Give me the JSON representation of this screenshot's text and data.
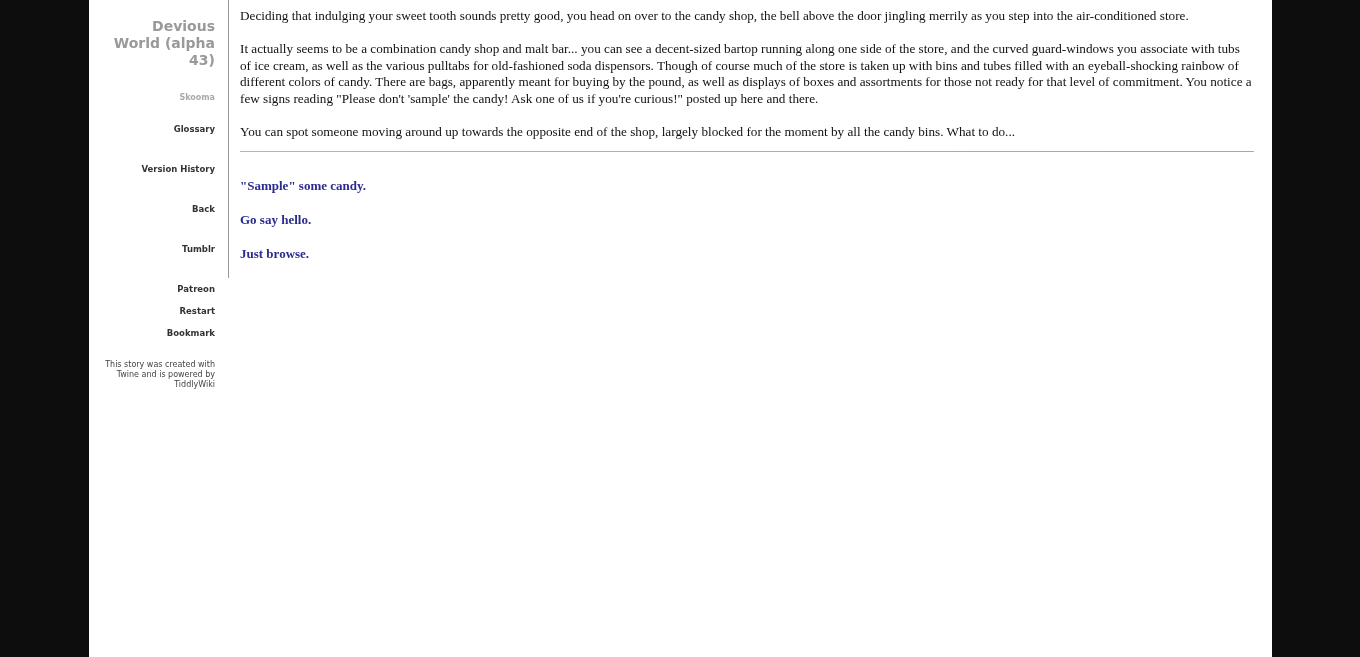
{
  "sidebar": {
    "title": "Devious World (alpha 43)",
    "subtitle": "Skooma",
    "menu": [
      {
        "label": "Glossary"
      },
      {
        "label": "Version History"
      },
      {
        "label": "Back"
      },
      {
        "label": "Tumblr"
      },
      {
        "label": "Patreon"
      },
      {
        "label": "Restart"
      },
      {
        "label": "Bookmark"
      }
    ],
    "credits": "This story was created with Twine and is powered by TiddlyWiki"
  },
  "passage": {
    "paragraphs": [
      "Deciding that indulging your sweet tooth sounds pretty good, you head on over to the candy shop, the bell above the door jingling merrily as you step into the air-conditioned store.",
      "It actually seems to be a combination candy shop and malt bar... you can see a decent-sized bartop running along one side of the store, and the curved guard-windows you associate with tubs of ice cream, as well as the various pulltabs for old-fashioned soda dispensors. Though of course much of the store is taken up with bins and tubes filled with an eyeball-shocking rainbow of different colors of candy. There are bags, apparently meant for buying by the pound, as well as displays of boxes and assortments for those not ready for that level of commitment. You notice a few signs reading \"Please don't 'sample' the candy! Ask one of us if you're curious!\" posted up here and there.",
      "You can spot someone moving around up towards the opposite end of the shop, largely blocked for the moment by all the candy bins. What to do..."
    ],
    "choices": [
      {
        "label": "\"Sample\" some candy."
      },
      {
        "label": "Go say hello."
      },
      {
        "label": "Just browse."
      }
    ]
  }
}
